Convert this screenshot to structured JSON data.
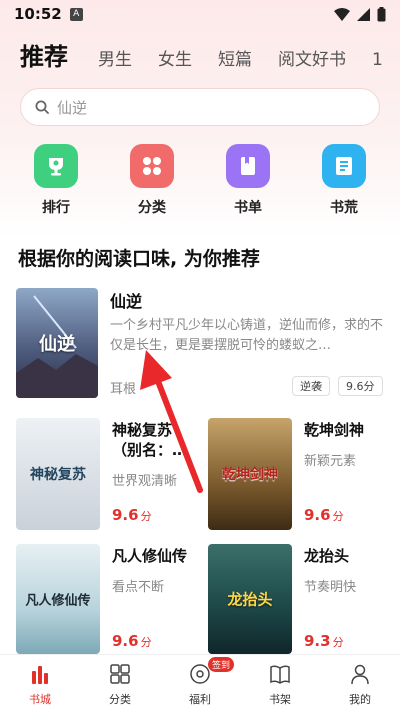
{
  "status": {
    "time": "10:52",
    "notif_letter": "A"
  },
  "tabs": [
    "推荐",
    "男生",
    "女生",
    "短篇",
    "阅文好书",
    "1"
  ],
  "search": {
    "placeholder": "仙逆"
  },
  "quick_links": [
    {
      "label": "排行",
      "icon": "trophy-icon",
      "color": "#3ed07f"
    },
    {
      "label": "分类",
      "icon": "grid-icon",
      "color": "#f26b6b"
    },
    {
      "label": "书单",
      "icon": "booklist-icon",
      "color": "#9b74f5"
    },
    {
      "label": "书荒",
      "icon": "book-icon",
      "color": "#2fb3f0"
    }
  ],
  "section_title": "根据你的阅读口味, 为你推荐",
  "featured": {
    "title": "仙逆",
    "cover_text": "仙逆",
    "description": "一个乡村平凡少年以心铸道，逆仙而修，求的不仅是长生，更是要摆脱可怜的蝼蚁之…",
    "author": "耳根",
    "tags": [
      "逆袭",
      "9.6分"
    ]
  },
  "books": [
    {
      "title": "神秘复苏（别名：…",
      "sub": "世界观清晰",
      "score": "9.6",
      "unit": "分",
      "cover_text": "神秘复苏",
      "cover_bg": "#d9dde2"
    },
    {
      "title": "乾坤剑神",
      "sub": "新颖元素",
      "score": "9.6",
      "unit": "分",
      "cover_text": "乾坤剑神",
      "cover_bg": "#7a5a2d"
    },
    {
      "title": "凡人修仙传",
      "sub": "看点不断",
      "score": "9.6",
      "unit": "分",
      "cover_text": "凡人修仙传",
      "cover_bg": "#cfe2e8"
    },
    {
      "title": "龙抬头",
      "sub": "节奏明快",
      "score": "9.3",
      "unit": "分",
      "cover_text": "龙抬头",
      "cover_bg": "#1e4a4a"
    }
  ],
  "bottom_nav": [
    {
      "label": "书城",
      "icon": "bookstore-icon",
      "active": true
    },
    {
      "label": "分类",
      "icon": "category-icon",
      "active": false
    },
    {
      "label": "福利",
      "icon": "gift-icon",
      "active": false,
      "badge": "签到"
    },
    {
      "label": "书架",
      "icon": "bookshelf-icon",
      "active": false
    },
    {
      "label": "我的",
      "icon": "profile-icon",
      "active": false
    }
  ],
  "colors": {
    "accent": "#e2312b"
  }
}
